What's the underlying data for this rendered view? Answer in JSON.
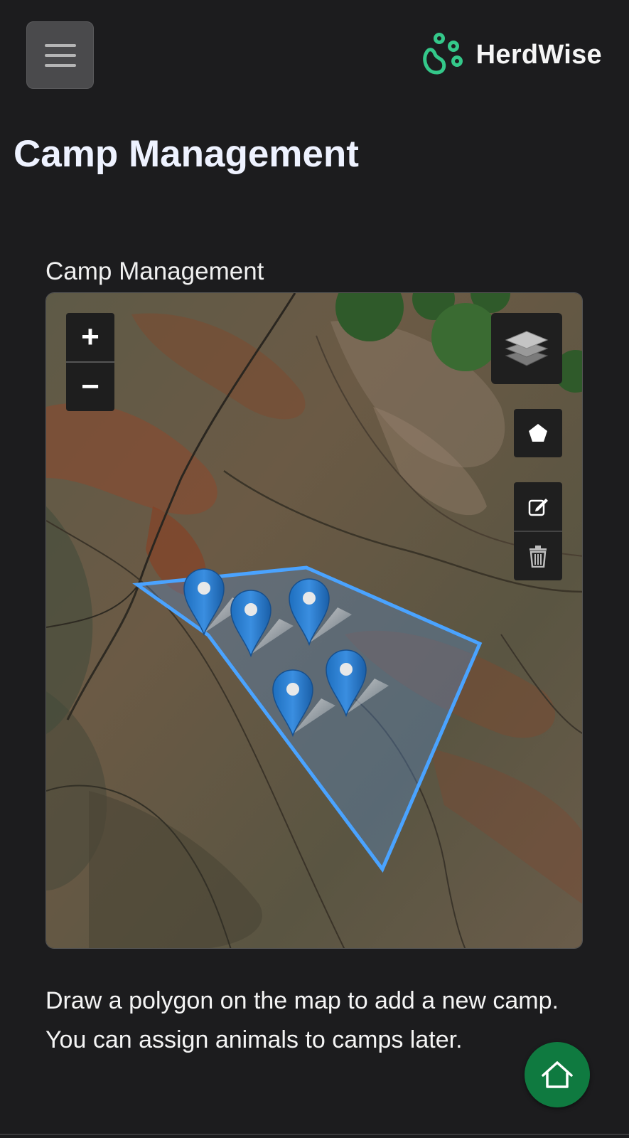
{
  "header": {
    "menu_icon": "hamburger-icon",
    "brand_icon": "paw-icon",
    "brand_name": "HerdWise",
    "brand_color": "#34c88a"
  },
  "page": {
    "title": "Camp Management"
  },
  "section": {
    "label": "Camp Management"
  },
  "map": {
    "imagery": "satellite",
    "camp_outline_color": "#4aa3ff",
    "marker_color": "#2b7fd0",
    "markers_count": 5,
    "controls": {
      "zoom_in_label": "+",
      "zoom_out_label": "−",
      "layers_icon": "layers-icon",
      "draw_polygon_icon": "pentagon-icon",
      "edit_icon": "edit-icon",
      "delete_icon": "trash-icon"
    }
  },
  "description": "Draw a polygon on the map to add a new camp. You can assign animals to camps later.",
  "fab": {
    "icon": "home-icon",
    "color": "#0f7a40"
  }
}
